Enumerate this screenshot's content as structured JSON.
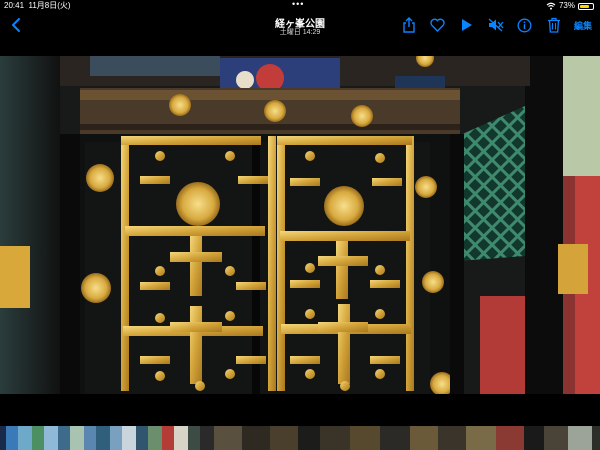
{
  "status_bar": {
    "time": "20:41",
    "date": "11月8日(火)",
    "battery": "73%",
    "battery_level": 0.73
  },
  "nav": {
    "title": "経ヶ峯公園",
    "subtitle": "土曜日 14:29",
    "edit_label": "編集",
    "accent_color": "#0a84ff",
    "icons": [
      "back-chevron-icon",
      "share-icon",
      "heart-icon",
      "play-icon",
      "mute-icon",
      "info-icon",
      "trash-icon"
    ]
  }
}
